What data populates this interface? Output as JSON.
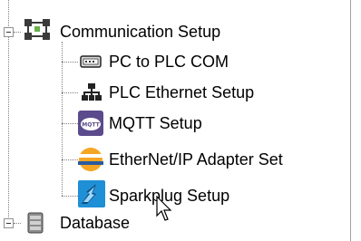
{
  "tree": {
    "items": [
      {
        "label": "Communication Setup",
        "icon": "communication-setup-icon",
        "expanded": true
      },
      {
        "label": "PC to PLC COM",
        "icon": "serial-port-icon"
      },
      {
        "label": "PLC Ethernet Setup",
        "icon": "network-icon"
      },
      {
        "label": "MQTT Setup",
        "icon": "mqtt-icon"
      },
      {
        "label": "EtherNet/IP Adapter Set",
        "icon": "ethernet-ip-icon"
      },
      {
        "label": "Sparkplug Setup",
        "icon": "sparkplug-icon"
      },
      {
        "label": "Database",
        "icon": "database-icon",
        "expanded": true
      }
    ]
  },
  "icons": {
    "mqtt_text": "MQTT"
  },
  "colors": {
    "mqtt_bg": "#5b4a8c",
    "ethernet_ip_orange": "#f5a623",
    "sparkplug_blue": "#1f8fd6",
    "tree_lines": "#808080"
  }
}
